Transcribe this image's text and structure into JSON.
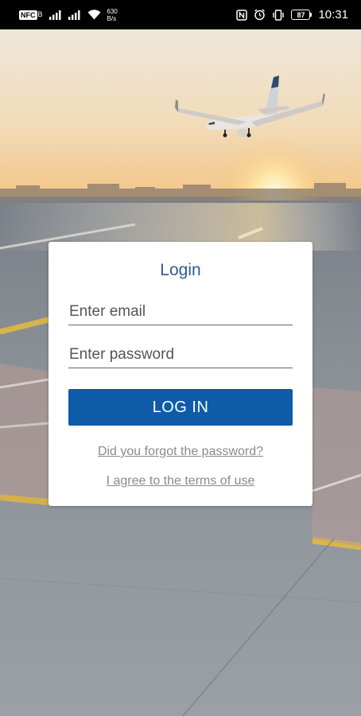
{
  "status_bar": {
    "sim_label": "NFC",
    "sim_suffix": "B",
    "net_speed_value": "630",
    "net_speed_unit": "B/s",
    "battery_level": "87",
    "time": "10:31",
    "icons": [
      "sim-icon",
      "signal-icon",
      "signal-icon",
      "wifi-icon",
      "nfc-icon",
      "alarm-icon",
      "vibrate-icon",
      "battery-icon"
    ]
  },
  "background": {
    "scene": "airport-runway-sunset-airplane",
    "colors": {
      "sky_top": "#efe3cf",
      "sky_bottom": "#f3c98a",
      "sun": "#fff4c8",
      "tarmac": "#8f959b",
      "yellow_line": "#d9b64c"
    }
  },
  "login": {
    "title": "Login",
    "email_placeholder": "Enter email",
    "email_value": "",
    "password_placeholder": "Enter password",
    "password_value": "",
    "login_button": "LOG IN",
    "forgot_link": "Did you forgot the password?",
    "terms_link": "I agree to the terms of use",
    "colors": {
      "title": "#2a5d95",
      "button": "#0e5ba7",
      "link": "#8a8a8a"
    }
  }
}
